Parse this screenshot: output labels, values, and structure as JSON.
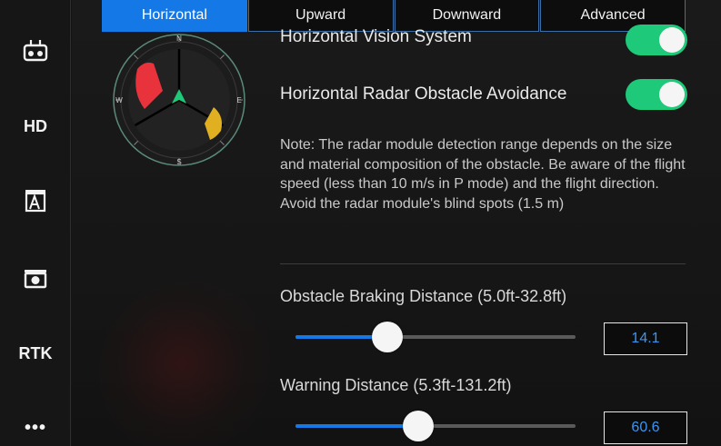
{
  "sidebar": {
    "items": [
      {
        "name": "remote-controller",
        "icon": "remote-controller-icon",
        "label": ""
      },
      {
        "name": "hd",
        "icon": "",
        "label": "HD"
      },
      {
        "name": "battery",
        "icon": "battery-icon",
        "label": ""
      },
      {
        "name": "camera",
        "icon": "camera-icon",
        "label": ""
      },
      {
        "name": "rtk",
        "icon": "",
        "label": "RTK"
      },
      {
        "name": "more",
        "icon": "more-icon",
        "label": "•••"
      }
    ]
  },
  "tabs": [
    {
      "label": "Horizontal",
      "active": true
    },
    {
      "label": "Upward",
      "active": false
    },
    {
      "label": "Downward",
      "active": false
    },
    {
      "label": "Advanced",
      "active": false
    }
  ],
  "radar": {
    "compass_letters": {
      "north": "N",
      "east": "E",
      "south": "S",
      "west": "W"
    }
  },
  "settings": {
    "vision_system": {
      "label": "Horizontal Vision System",
      "enabled": true
    },
    "radar_avoidance": {
      "label": "Horizontal Radar Obstacle Avoidance",
      "enabled": true
    },
    "note": "Note: The radar module detection range depends on the size and material composition of the obstacle. Be aware of the flight speed (less than 10 m/s in P mode) and the flight direction. Avoid the radar module's blind spots (1.5 m)"
  },
  "sliders": {
    "braking": {
      "label": "Obstacle Braking Distance (5.0ft-32.8ft)",
      "value": "14.1",
      "min": 5.0,
      "max": 32.8,
      "num": 14.1
    },
    "warning": {
      "label": "Warning Distance (5.3ft-131.2ft)",
      "value": "60.6",
      "min": 5.3,
      "max": 131.2,
      "num": 60.6
    }
  },
  "colors": {
    "accent": "#1479e6",
    "toggle_on": "#1ec97a",
    "value_text": "#3d95f0",
    "radar_obstacle_near": "#e8323c",
    "radar_obstacle_far": "#e0b020",
    "drone_marker": "#1ec97a"
  }
}
